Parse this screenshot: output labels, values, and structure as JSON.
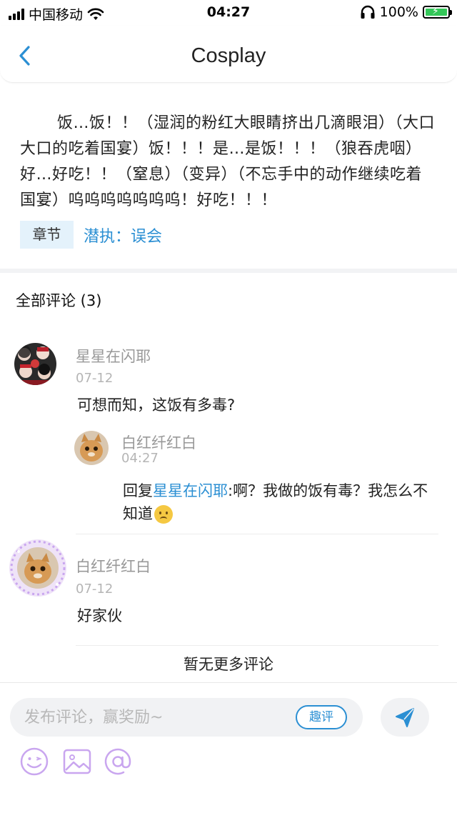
{
  "status_bar": {
    "carrier": "中国移动",
    "time": "04:27",
    "battery": "100%"
  },
  "nav": {
    "title": "Cosplay"
  },
  "content": {
    "text": "饭…饭！！（湿润的粉红大眼睛挤出几滴眼泪）（大口大口的吃着国宴）饭！！！是…是饭！！！（狼吞虎咽）好…好吃！！（窒息）（变异）（不忘手中的动作继续吃着国宴）呜呜呜呜呜呜呜！好吃！！！",
    "chapter_badge": "章节",
    "chapter_link": "潜执：误会"
  },
  "comments": {
    "title": "全部评论 (3)",
    "items": [
      {
        "username": "星星在闪耶",
        "date": "07-12",
        "text": "可想而知，这饭有多毒?",
        "reply": {
          "username": "白红纤红白",
          "date": "04:27",
          "prefix": "回复",
          "target": "星星在闪耶",
          "text": ":啊？我做的饭有毒？我怎么不知道"
        }
      },
      {
        "username": "白红纤红白",
        "date": "07-12",
        "text": "好家伙"
      }
    ],
    "no_more": "暂无更多评论"
  },
  "input_bar": {
    "placeholder": "发布评论，赢奖励~",
    "quping_label": "趣评",
    "icons": [
      "smiley-icon",
      "image-icon",
      "at-icon",
      "send-icon"
    ]
  },
  "colors": {
    "accent": "#2b8fd3",
    "badge_bg": "#e4f2fb",
    "icon_purple": "#c9a6ef"
  }
}
